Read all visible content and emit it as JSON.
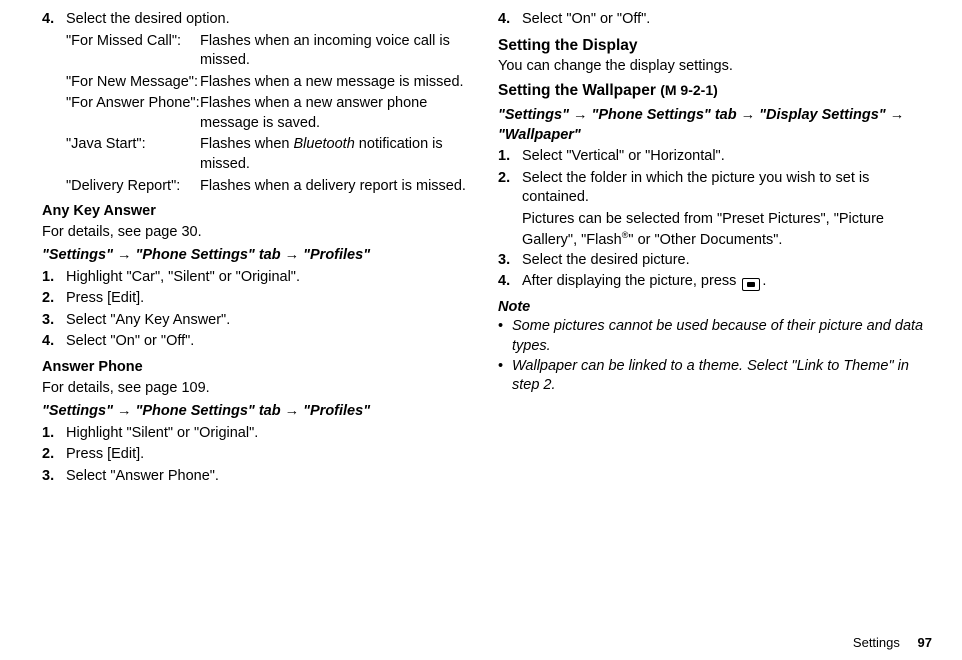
{
  "left": {
    "step4_num": "4.",
    "step4_text": "Select the desired option.",
    "options": [
      {
        "label": "\"For Missed Call\":",
        "desc": "Flashes when an incoming voice call is missed."
      },
      {
        "label": "\"For New Message\":",
        "desc": "Flashes when a new message is missed."
      },
      {
        "label": "\"For Answer Phone\":",
        "desc": "Flashes when a new answer phone message is saved."
      },
      {
        "label": "\"Java Start\":",
        "desc_pre": "Flashes when ",
        "desc_em": "Bluetooth",
        "desc_post": " notification is missed."
      },
      {
        "label": "\"Delivery Report\":",
        "desc": "Flashes when a delivery report is missed."
      }
    ],
    "anyKey": {
      "title": "Any Key Answer",
      "sub": "For details, see page 30.",
      "path": "\"Settings\" → \"Phone Settings\" tab → \"Profiles\"",
      "steps": [
        {
          "n": "1.",
          "t": "Highlight \"Car\", \"Silent\" or \"Original\"."
        },
        {
          "n": "2.",
          "t": "Press [Edit]."
        },
        {
          "n": "3.",
          "t": "Select \"Any Key Answer\"."
        },
        {
          "n": "4.",
          "t": "Select \"On\" or \"Off\"."
        }
      ]
    },
    "ansPhone": {
      "title": "Answer Phone",
      "sub": "For details, see page 109.",
      "path": "\"Settings\" → \"Phone Settings\" tab → \"Profiles\"",
      "steps": [
        {
          "n": "1.",
          "t": "Highlight \"Silent\" or \"Original\"."
        },
        {
          "n": "2.",
          "t": "Press [Edit]."
        },
        {
          "n": "3.",
          "t": "Select \"Answer Phone\"."
        }
      ]
    }
  },
  "right": {
    "step4_num": "4.",
    "step4_text": "Select \"On\" or \"Off\".",
    "display_title": "Setting the Display",
    "display_sub": "You can change the display settings.",
    "wallpaper_title": "Setting the Wallpaper",
    "wallpaper_code": "(M 9-2-1)",
    "wallpaper_path": "\"Settings\" → \"Phone Settings\" tab → \"Display Settings\" → \"Wallpaper\"",
    "wallpaper_steps": [
      {
        "n": "1.",
        "t": "Select \"Vertical\" or \"Horizontal\"."
      },
      {
        "n": "2.",
        "t": "Select the folder in which the picture you wish to set is contained."
      },
      {
        "n": "3.",
        "t": "Select the desired picture."
      }
    ],
    "wallpaper_subnote_pre": "Pictures can be selected from \"Preset Pictures\", \"Picture Gallery\", \"Flash",
    "wallpaper_subnote_reg": "®",
    "wallpaper_subnote_post": "\" or \"Other Documents\".",
    "step4b_n": "4.",
    "step4b_t_pre": "After displaying the picture, press ",
    "step4b_t_post": ".",
    "note_label": "Note",
    "notes": [
      "Some pictures cannot be used because of their picture and data types.",
      "Wallpaper can be linked to a theme. Select \"Link to Theme\" in step 2."
    ]
  },
  "footer": {
    "section": "Settings",
    "page": "97"
  }
}
